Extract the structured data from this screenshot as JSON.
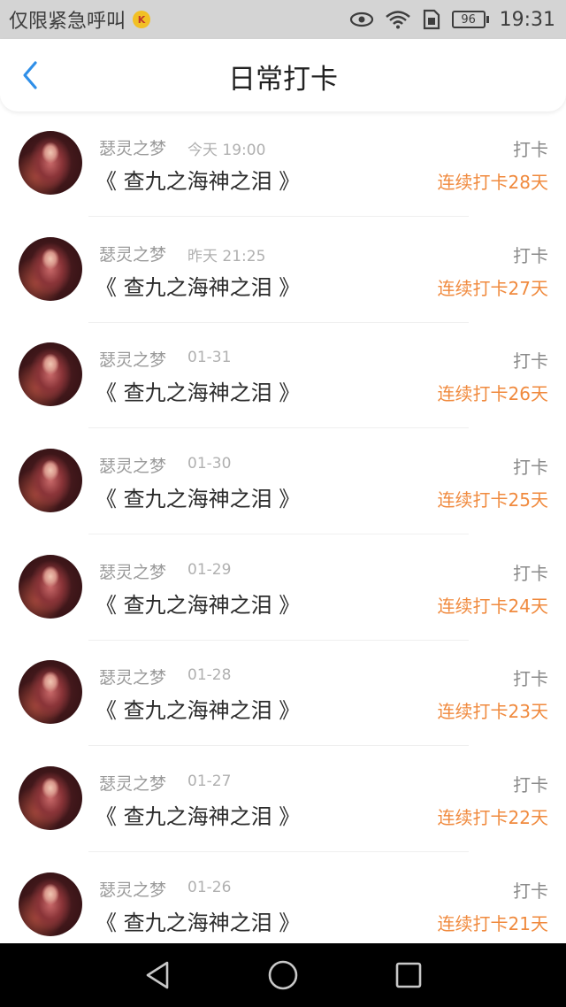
{
  "status_bar": {
    "carrier": "仅限紧急呼叫",
    "battery": "96",
    "time": "19:31",
    "icons": [
      "eye-icon",
      "wifi-icon",
      "sim-icon",
      "battery-icon"
    ]
  },
  "header": {
    "title": "日常打卡",
    "back_icon": "chevron-left-icon"
  },
  "checkins": [
    {
      "name": "瑟灵之梦",
      "time": "今天 19:00",
      "book": "《 查九之海神之泪 》",
      "action": "打卡",
      "streak": "连续打卡28天"
    },
    {
      "name": "瑟灵之梦",
      "time": "昨天 21:25",
      "book": "《 查九之海神之泪 》",
      "action": "打卡",
      "streak": "连续打卡27天"
    },
    {
      "name": "瑟灵之梦",
      "time": "01-31",
      "book": "《 查九之海神之泪 》",
      "action": "打卡",
      "streak": "连续打卡26天"
    },
    {
      "name": "瑟灵之梦",
      "time": "01-30",
      "book": "《 查九之海神之泪 》",
      "action": "打卡",
      "streak": "连续打卡25天"
    },
    {
      "name": "瑟灵之梦",
      "time": "01-29",
      "book": "《 查九之海神之泪 》",
      "action": "打卡",
      "streak": "连续打卡24天"
    },
    {
      "name": "瑟灵之梦",
      "time": "01-28",
      "book": "《 查九之海神之泪 》",
      "action": "打卡",
      "streak": "连续打卡23天"
    },
    {
      "name": "瑟灵之梦",
      "time": "01-27",
      "book": "《 查九之海神之泪 》",
      "action": "打卡",
      "streak": "连续打卡22天"
    },
    {
      "name": "瑟灵之梦",
      "time": "01-26",
      "book": "《 查九之海神之泪 》",
      "action": "打卡",
      "streak": "连续打卡21天"
    }
  ],
  "system_nav": [
    "back-triangle-icon",
    "home-circle-icon",
    "recents-square-icon"
  ],
  "colors": {
    "accent": "#2f8fe8",
    "streak": "#f08a3e",
    "status_bar_bg": "#d4d4d4"
  }
}
